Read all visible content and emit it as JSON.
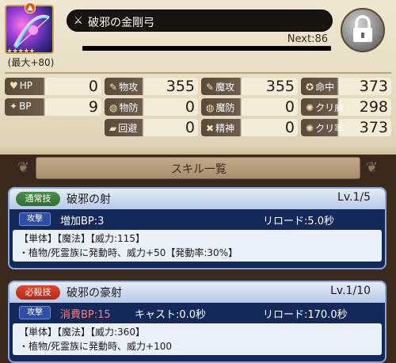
{
  "weapon": {
    "name": "破邪の金剛弓",
    "max_label": "(最大+80)",
    "stars": "★★★★★",
    "next_label": "Next:86",
    "element_icon": "fire-icon"
  },
  "stats": [
    {
      "key": "hp",
      "label": "HP",
      "icon": "♥",
      "value": "0"
    },
    {
      "key": "phys-atk",
      "label": "物攻",
      "icon": "✎",
      "value": "355"
    },
    {
      "key": "mag-atk",
      "label": "魔攻",
      "icon": "✎",
      "value": "355"
    },
    {
      "key": "hit",
      "label": "命中",
      "icon": "✪",
      "value": "373"
    },
    {
      "key": "bp",
      "label": "BP",
      "icon": "✦",
      "value": "9"
    },
    {
      "key": "phys-def",
      "label": "物防",
      "icon": "◍",
      "value": "0"
    },
    {
      "key": "mag-def",
      "label": "魔防",
      "icon": "◍",
      "value": "0"
    },
    {
      "key": "crit-dmg",
      "label": "クリ威",
      "icon": "✺",
      "value": "298"
    },
    {
      "key": "evade",
      "label": "回避",
      "icon": "▰",
      "value": "0"
    },
    {
      "key": "spirit",
      "label": "精神",
      "icon": "✖",
      "value": "0"
    },
    {
      "key": "crit-rate",
      "label": "クリ率",
      "icon": "✺",
      "value": "373"
    }
  ],
  "skill_list": {
    "title": "スキル一覧"
  },
  "skills": [
    {
      "badge": "通常技",
      "name": "破邪の射",
      "level": "Lv.1/5",
      "tag": "攻撃",
      "bp": "増加BP:3",
      "cast": "",
      "reload": "リロード:5.0秒",
      "desc_line1": "【単体】【魔法】【威力:115】",
      "desc_line2": "・植物/死霊族に発動時、威力+50【発動率:30%】"
    },
    {
      "badge": "必殺技",
      "name": "破邪の豪射",
      "level": "Lv.1/10",
      "tag": "攻撃",
      "bp": "消費BP:15",
      "cast": "キャスト:0.0秒",
      "reload": "リロード:170.0秒",
      "desc_line1": "【単体】【魔法】【威力:360】",
      "desc_line2": "・植物/死霊族に発動時、威力+100"
    }
  ],
  "colors": {
    "parchment": "#efe7d2",
    "card_bg": "#14295a",
    "normal_badge": "#2f6c31",
    "special_badge": "#b1281a",
    "cost_text": "#ff7c7c"
  }
}
